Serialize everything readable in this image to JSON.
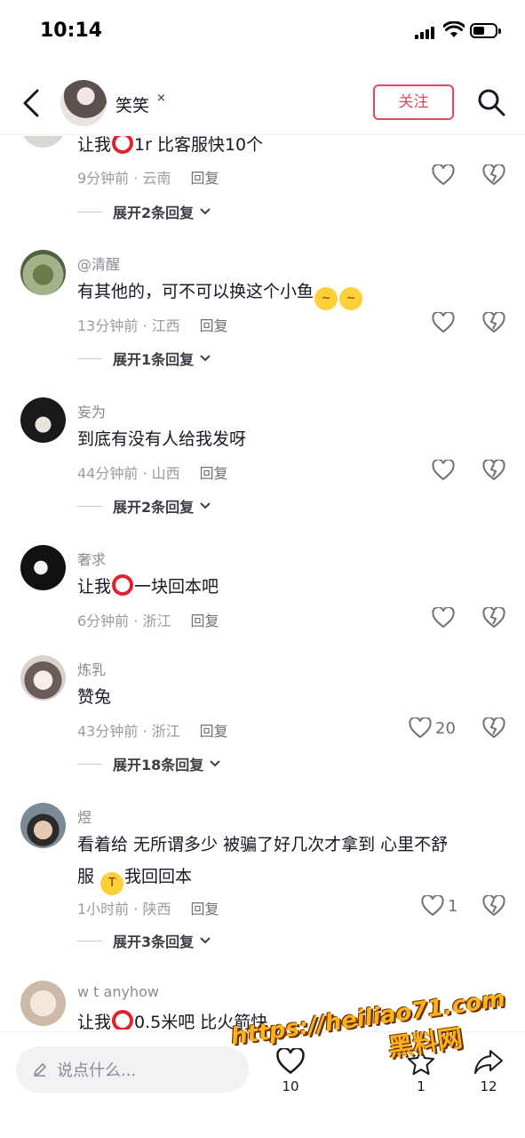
{
  "status_bar": {
    "time": "10:14"
  },
  "header": {
    "name": "笑笑",
    "close_mark": "×",
    "follow_label": "关注"
  },
  "comments": [
    {
      "id": "c0",
      "text_parts": [
        "让我",
        "ring",
        "1r  比客服快10个"
      ],
      "time_loc": "9分钟前 · 云南",
      "reply": "回复",
      "likes": "",
      "expand": "展开2条回复"
    },
    {
      "id": "c1",
      "username": "@清醒",
      "text_parts": [
        "有其他的，可不可以换这个小鱼",
        "emoji:🥴",
        "emoji:🥴"
      ],
      "time_loc": "13分钟前 · 江西",
      "reply": "回复",
      "likes": "",
      "expand": "展开1条回复"
    },
    {
      "id": "c2",
      "username": "妄为",
      "text": "到底有没有人给我发呀",
      "time_loc": "44分钟前 · 山西",
      "reply": "回复",
      "likes": "",
      "expand": "展开2条回复"
    },
    {
      "id": "c3",
      "username": "奢求",
      "text_parts": [
        "让我",
        "ring",
        "一块回本吧"
      ],
      "time_loc": "6分钟前 · 浙江",
      "reply": "回复",
      "likes": "",
      "expand": ""
    },
    {
      "id": "c4",
      "username": "炼乳",
      "text": "赞兔",
      "time_loc": "43分钟前 · 浙江",
      "reply": "回复",
      "likes": "20",
      "expand": "展开18条回复"
    },
    {
      "id": "c5",
      "username": "煜",
      "text_line1": "看着给  无所谓多少  被骗了好几次才拿到  心里不舒",
      "text_line2": "服  ",
      "text_line2b": "我回回本",
      "time_loc": "1小时前 · 陕西",
      "reply": "回复",
      "likes": "1",
      "expand": "展开3条回复"
    },
    {
      "id": "c6",
      "username": "w t anyhow",
      "text_parts": [
        "让我",
        "ring",
        "0.5米吧 比火箭快"
      ]
    }
  ],
  "bottom_bar": {
    "placeholder": "说点什么...",
    "like_count": "10",
    "star_count": "1",
    "share_count": "12"
  },
  "watermark": {
    "url": "https://heiliao71.com",
    "cn": "黑料网"
  },
  "colors": {
    "accent": "#e4485c",
    "ring": "#e0242f",
    "text": "#161823",
    "muted": "#9a9ba1"
  },
  "icons": [
    "back-icon",
    "search-icon",
    "heart-icon",
    "broken-heart-icon",
    "chevron-down-icon",
    "pen-icon",
    "star-icon",
    "share-icon"
  ]
}
